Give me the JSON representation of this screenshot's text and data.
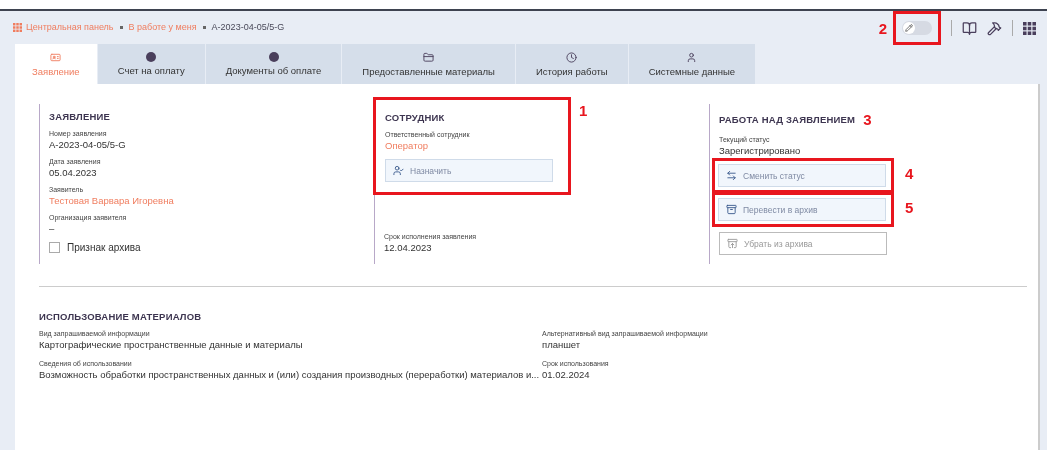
{
  "breadcrumb": [
    {
      "label": "Центральная панель",
      "kind": "link"
    },
    {
      "label": "В работе у меня",
      "kind": "link"
    },
    {
      "label": "A-2023-04-05/5-G",
      "kind": "current"
    }
  ],
  "toolbar": {
    "edit_toggle": {
      "on": false,
      "marker": "2"
    }
  },
  "tabs": [
    {
      "label": "Заявление",
      "selected": true
    },
    {
      "label": "Счет на оплату",
      "selected": false
    },
    {
      "label": "Документы об оплате",
      "selected": false
    },
    {
      "label": "Предоставленные материалы",
      "selected": false
    },
    {
      "label": "История работы",
      "selected": false
    },
    {
      "label": "Системные данные",
      "selected": false
    }
  ],
  "application": {
    "title": "ЗАЯВЛЕНИЕ",
    "fields": [
      {
        "label": "Номер заявления",
        "value": "A-2023-04-05/5-G",
        "kind": "text"
      },
      {
        "label": "Дата заявления",
        "value": "05.04.2023",
        "kind": "text"
      },
      {
        "label": "Заявитель",
        "value": "Тестовая Варвара Игоревна",
        "kind": "link"
      },
      {
        "label": "Организация заявителя",
        "value": "–",
        "kind": "text"
      }
    ],
    "archive_checkbox": {
      "label": "Признак архива",
      "checked": false
    }
  },
  "employee": {
    "title": "СОТРУДНИК",
    "marker": "1",
    "fields": [
      {
        "label": "Ответственный сотрудник",
        "value": "Оператор",
        "kind": "link"
      }
    ],
    "button": {
      "label": "Назначить",
      "disabled": false
    },
    "deadline": {
      "label": "Срок исполнения заявления",
      "value": "12.04.2023",
      "kind": "text"
    }
  },
  "work": {
    "title": "РАБОТА НАД ЗАЯВЛЕНИЕМ",
    "marker": "3",
    "fields": [
      {
        "label": "Текущий статус",
        "value": "Зарегистрировано",
        "kind": "text"
      }
    ],
    "buttons": [
      {
        "label": "Сменить статус",
        "disabled": false,
        "marker": "4"
      },
      {
        "label": "Перевести в архив",
        "disabled": false,
        "marker": "5"
      },
      {
        "label": "Убрать из архива",
        "disabled": true
      }
    ]
  },
  "materials": {
    "title": "ИСПОЛЬЗОВАНИЕ МАТЕРИАЛОВ",
    "fields": [
      {
        "label": "Вид запрашиваемой информации",
        "value": "Картографические пространственные данные и материалы",
        "kind": "text"
      },
      {
        "label": "Альтернативный вид запрашиваемой информации",
        "value": "планшет",
        "kind": "text"
      },
      {
        "label": "Сведения об использовании",
        "value": "Возможность обработки пространственных данных и (или) создания производных (переработки) материалов и...",
        "kind": "text"
      },
      {
        "label": "Срок использования",
        "value": "01.02.2024",
        "kind": "text"
      }
    ]
  }
}
